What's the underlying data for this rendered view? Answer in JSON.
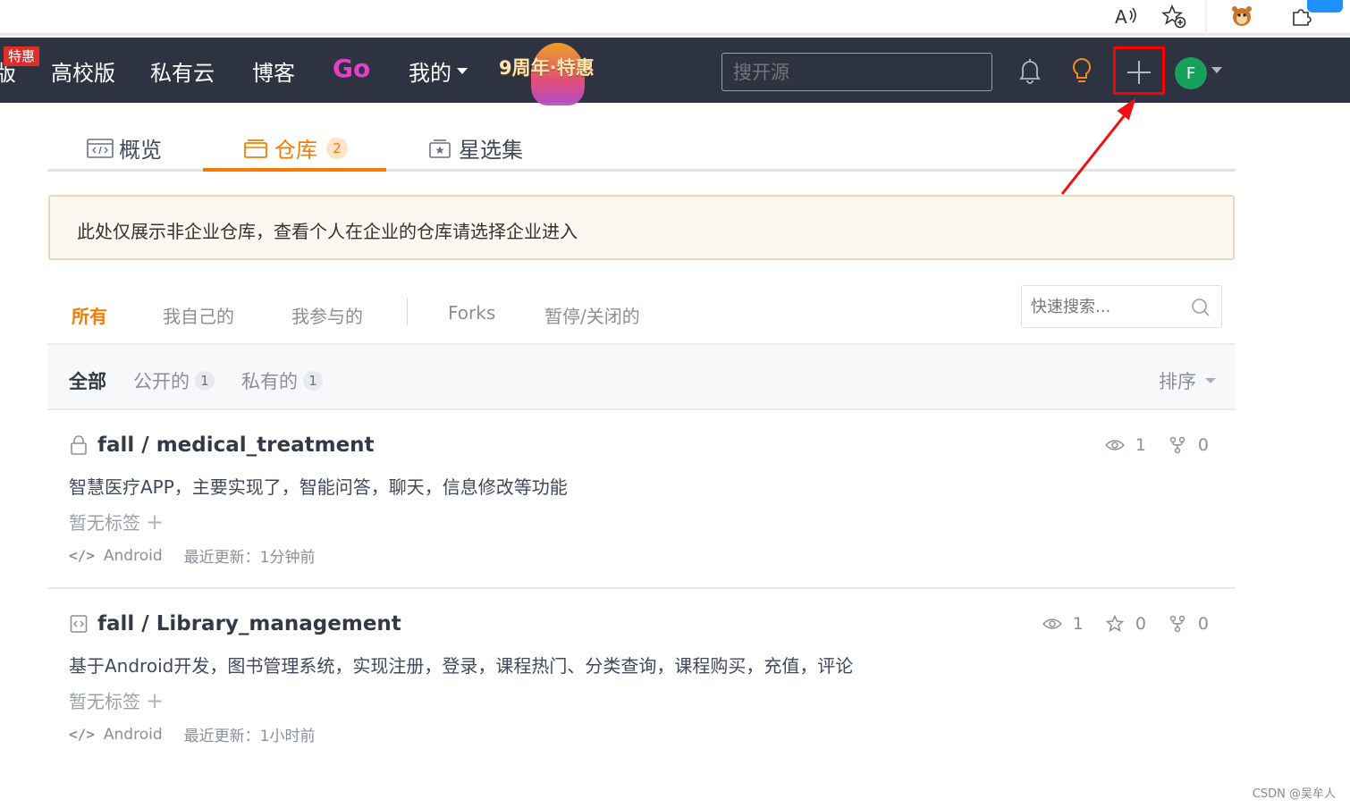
{
  "browser": {
    "icons": [
      "read-aloud-icon",
      "favorites-add-icon",
      "extension-avatar-icon",
      "extensions-puzzle-icon"
    ]
  },
  "navbar": {
    "special_badge": "特惠",
    "cut_link": "版",
    "links": [
      "高校版",
      "私有云",
      "博客"
    ],
    "go_logo": "Go",
    "mine_label": "我的",
    "promo_text": "9周年·特惠",
    "search_placeholder": "搜开源",
    "avatar_letter": "F",
    "colors": {
      "bg": "#2e3342",
      "accent": "#f57c00",
      "highlight": "#ff0000",
      "avatar": "#15a05c"
    }
  },
  "tabs": [
    {
      "label": "概览",
      "icon": "code-window-icon"
    },
    {
      "label": "仓库",
      "icon": "folder-icon",
      "count": "2"
    },
    {
      "label": "星选集",
      "icon": "star-box-icon"
    }
  ],
  "notice": "此处仅展示非企业仓库，查看个人在企业的仓库请选择企业进入",
  "filters": [
    "所有",
    "我自己的",
    "我参与的",
    "Forks",
    "暂停/关闭的"
  ],
  "quick_search_placeholder": "快速搜索...",
  "subfilters": {
    "all": "全部",
    "public": "公开的",
    "public_count": "1",
    "private": "私有的",
    "private_count": "1",
    "sort": "排序"
  },
  "repos": [
    {
      "title": "fall / medical_treatment",
      "icon": "lock-icon",
      "desc": "智慧医疗APP，主要实现了，智能问答，聊天，信息修改等功能",
      "tags": "暂无标签",
      "lang": "Android",
      "updated": "最近更新：1分钟前",
      "watch": "1",
      "fork": "0"
    },
    {
      "title": "fall / Library_management",
      "icon": "repo-code-icon",
      "desc": "基于Android开发，图书管理系统，实现注册，登录，课程热门、分类查询，课程购买，充值，评论",
      "tags": "暂无标签",
      "lang": "Android",
      "updated": "最近更新：1小时前",
      "watch": "1",
      "star": "0",
      "fork": "0"
    }
  ],
  "watermark": "CSDN @吴牟人"
}
